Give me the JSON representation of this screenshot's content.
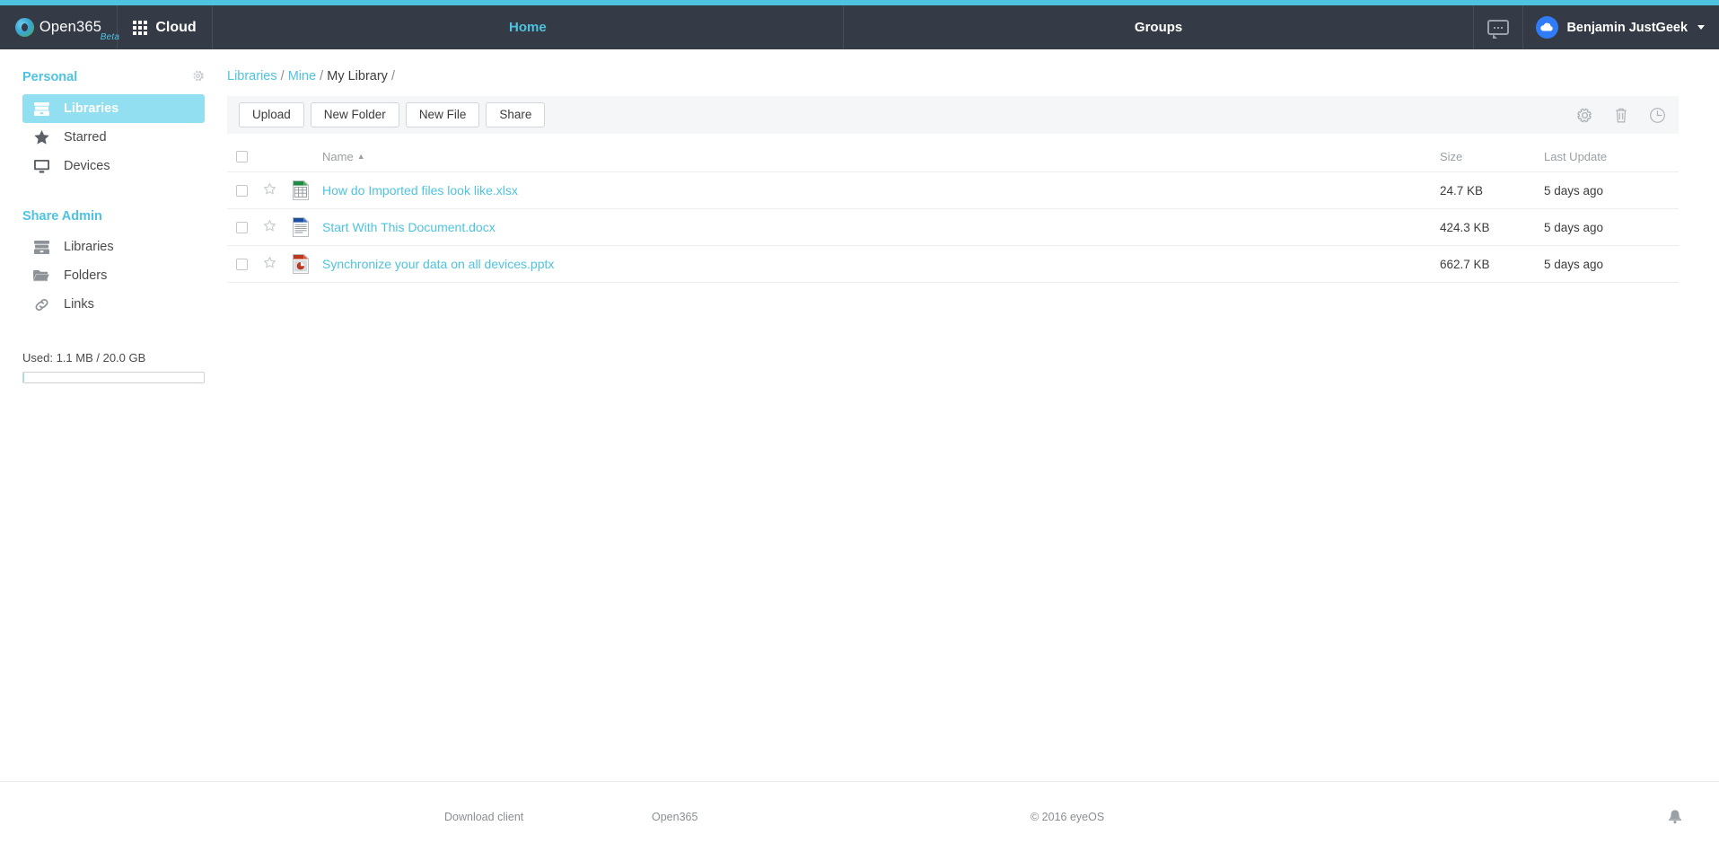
{
  "theme": {
    "accent": "#4ec3e0",
    "navbar_bg": "#343a46",
    "link": "#4ec3e0",
    "active_sidebar_bg": "#91dff0",
    "toolbar_bg": "#f5f6f7"
  },
  "navbar": {
    "brand": "Open365",
    "brand_sub": "Beta",
    "brand_logo_icon": "open365-logo-icon",
    "cloud_label": "Cloud",
    "cloud_icon": "app-grid-icon",
    "sections": [
      {
        "label": "Home",
        "active": true
      },
      {
        "label": "Groups",
        "active": false
      }
    ],
    "chat_icon": "chat-bubble-icon",
    "avatar_icon": "cloud-avatar-icon",
    "user_name": "Benjamin JustGeek",
    "caret_icon": "chevron-down-icon"
  },
  "sidebar": {
    "personal": {
      "title": "Personal",
      "settings_icon": "gear-icon",
      "items": [
        {
          "label": "Libraries",
          "icon": "library-icon",
          "active": true
        },
        {
          "label": "Starred",
          "icon": "star-icon",
          "active": false
        },
        {
          "label": "Devices",
          "icon": "monitor-icon",
          "active": false
        }
      ]
    },
    "share_admin": {
      "title": "Share Admin",
      "items": [
        {
          "label": "Libraries",
          "icon": "library-icon"
        },
        {
          "label": "Folders",
          "icon": "folder-icon"
        },
        {
          "label": "Links",
          "icon": "link-icon"
        }
      ]
    },
    "usage": {
      "text": "Used: 1.1 MB / 20.0 GB",
      "used": "1.1 MB",
      "total": "20.0 GB",
      "percent": 0.5
    }
  },
  "breadcrumb": {
    "libraries": "Libraries",
    "mine": "Mine",
    "current": "My Library",
    "separator": "/",
    "trailing": "/"
  },
  "toolbar": {
    "upload_label": "Upload",
    "new_folder_label": "New Folder",
    "new_file_label": "New File",
    "share_label": "Share",
    "icons": [
      {
        "name": "gear-icon"
      },
      {
        "name": "trash-icon"
      },
      {
        "name": "history-clock-icon"
      }
    ]
  },
  "table": {
    "columns": {
      "name": "Name",
      "size": "Size",
      "last_update": "Last Update"
    },
    "sort": {
      "column": "Name",
      "direction": "asc",
      "arrow": "▲"
    },
    "rows": [
      {
        "name": "How do Imported files look like.xlsx",
        "type": "xlsx",
        "icon": "spreadsheet-file-icon",
        "size": "24.7 KB",
        "last_update": "5 days ago",
        "starred": false,
        "selected": false
      },
      {
        "name": "Start With This Document.docx",
        "type": "docx",
        "icon": "document-file-icon",
        "size": "424.3 KB",
        "last_update": "5 days ago",
        "starred": false,
        "selected": false
      },
      {
        "name": "Synchronize your data on all devices.pptx",
        "type": "pptx",
        "icon": "presentation-file-icon",
        "size": "662.7 KB",
        "last_update": "5 days ago",
        "starred": false,
        "selected": false
      }
    ]
  },
  "footer": {
    "download_client": "Download client",
    "brand": "Open365",
    "copyright": "© 2016 eyeOS",
    "bell_icon": "bell-icon"
  }
}
